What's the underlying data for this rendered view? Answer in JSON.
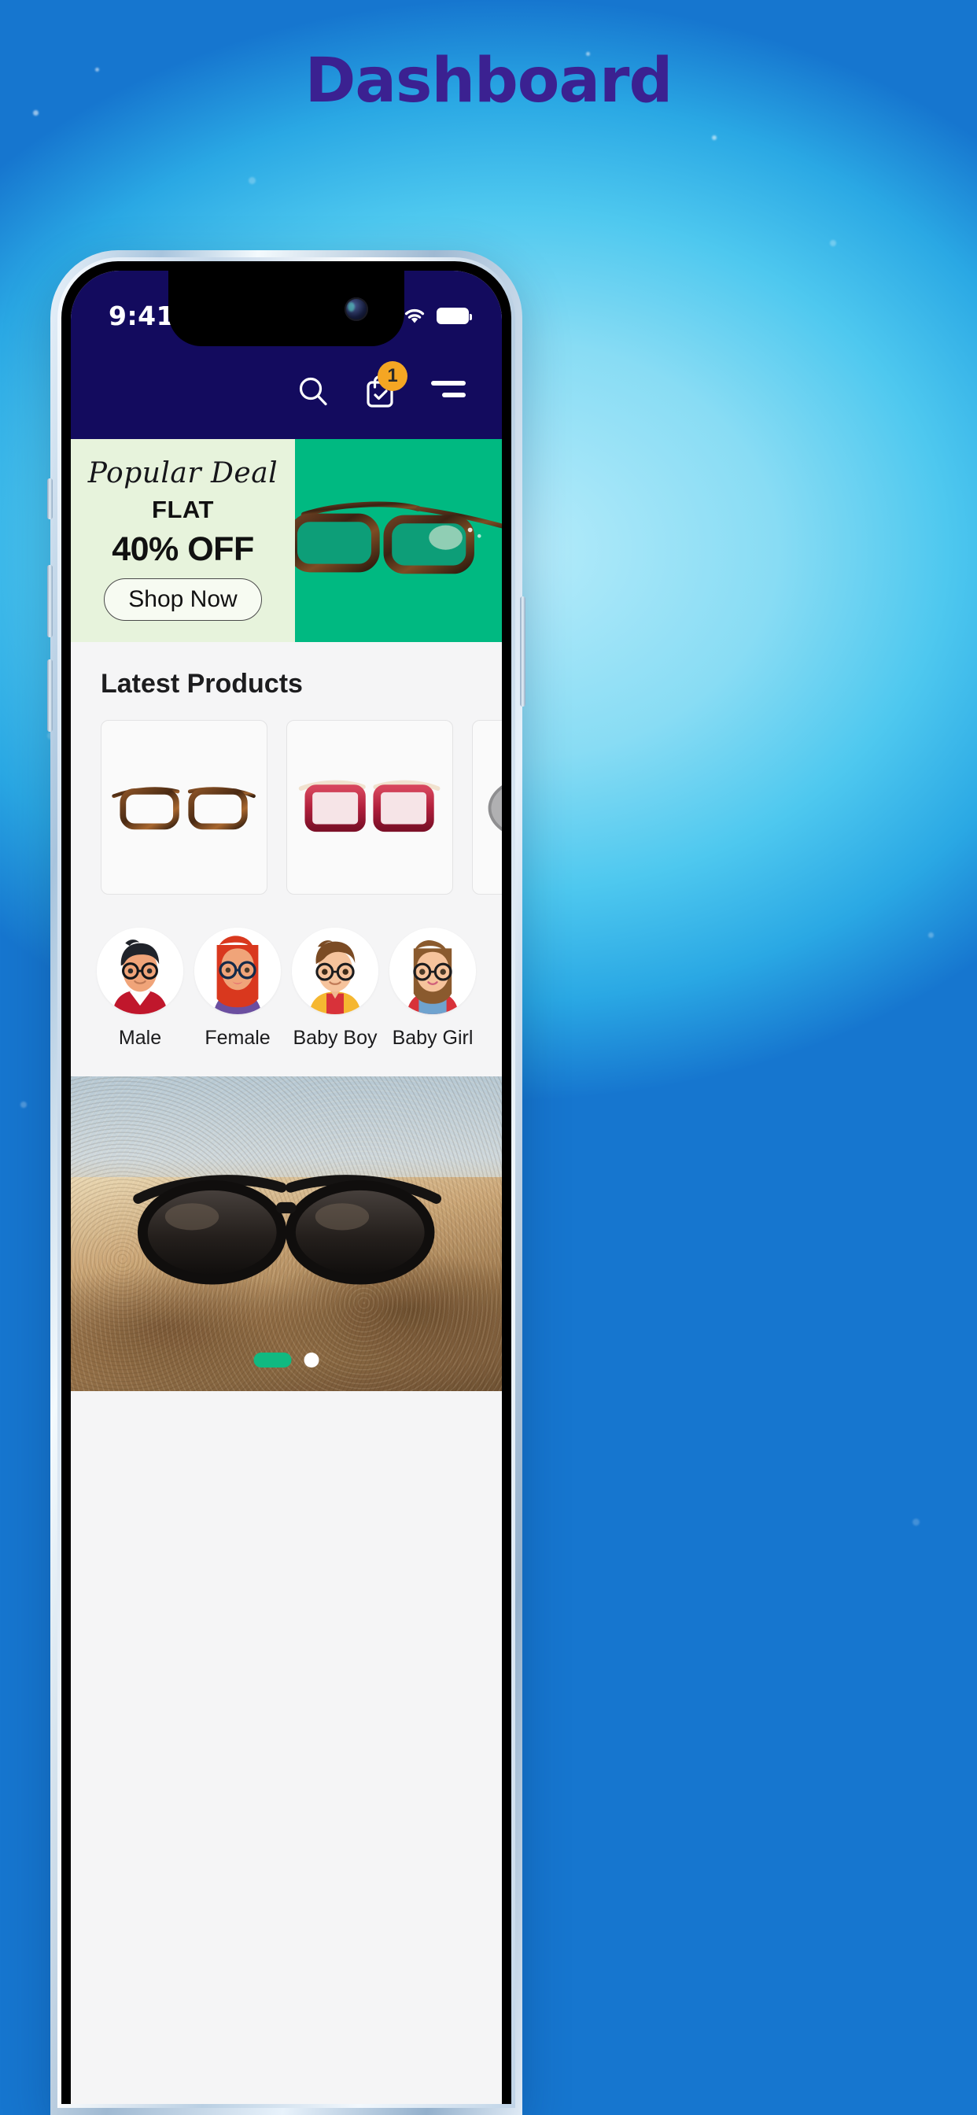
{
  "page": {
    "title": "Dashboard",
    "title_color": "#3b2191",
    "background_color": "#4ec8ef"
  },
  "status_bar": {
    "time": "9:41",
    "signal_icon": "cellular-signal-icon",
    "wifi_icon": "wifi-icon",
    "battery_icon": "battery-full-icon"
  },
  "navbar": {
    "search_icon": "search-icon",
    "cart_icon": "shopping-cart-icon",
    "cart_badge_count": "1",
    "cart_badge_color": "#f5a623",
    "menu_icon": "hamburger-menu-icon",
    "background_color": "#130b5e"
  },
  "banner": {
    "title": "Popular Deal",
    "flat_label": "FLAT",
    "discount": "40% OFF",
    "cta_label": "Shop Now",
    "left_background": "#e7f3dc",
    "right_background": "#00b981",
    "product_image": "eyeglasses-tortoise-shell-image"
  },
  "latest_products": {
    "heading": "Latest Products",
    "items": [
      {
        "image": "eyeglasses-tortoise-brown-image",
        "alt": "Tortoise shell eyeglasses"
      },
      {
        "image": "eyeglasses-red-frame-image",
        "alt": "Red frame eyeglasses"
      },
      {
        "image": "sunglasses-grey-lens-image",
        "alt": "Grey lens sunglasses"
      }
    ]
  },
  "categories": [
    {
      "label": "Male",
      "avatar": "avatar-male-icon"
    },
    {
      "label": "Female",
      "avatar": "avatar-female-icon"
    },
    {
      "label": "Baby Boy",
      "avatar": "avatar-baby-boy-icon"
    },
    {
      "label": "Baby Girl",
      "avatar": "avatar-baby-girl-icon"
    }
  ],
  "hero_photo": {
    "image": "sunglasses-on-beach-sand-photo",
    "pagination": {
      "active_index": 0,
      "count": 2,
      "active_color": "#10b981",
      "inactive_color": "#ffffff"
    }
  }
}
